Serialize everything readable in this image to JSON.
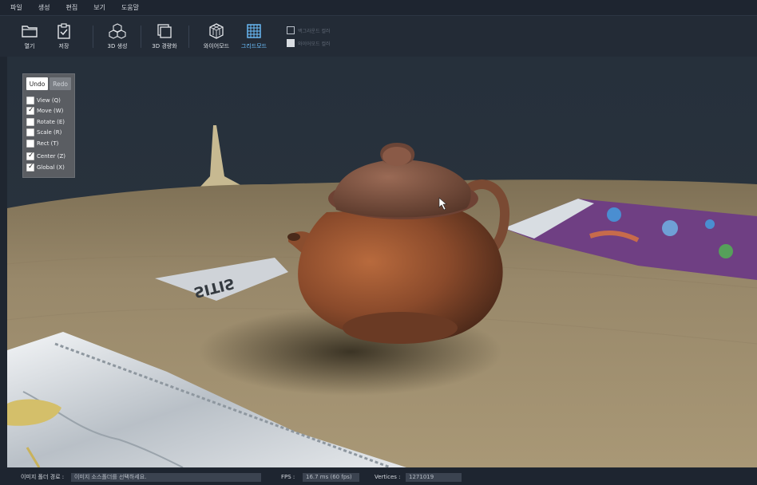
{
  "menubar": {
    "items": [
      "파일",
      "생성",
      "편집",
      "보기",
      "도움말"
    ]
  },
  "toolbar": {
    "open_label": "열기",
    "save_label": "저장",
    "gen3d_label": "3D 생성",
    "lightweight_label": "3D 경량화",
    "wireframe_label": "와이어모드",
    "grid_label": "그리드모드",
    "active_tool": "그리드모드",
    "bg_color_label": "백그라운드 컬러",
    "wire_color_label": "와이어모드 컬러",
    "accent_color": "#6cc0ff"
  },
  "panel": {
    "undo_label": "Undo",
    "redo_label": "Redo",
    "options": [
      {
        "label": "View (Q)",
        "checked": false
      },
      {
        "label": "Move (W)",
        "checked": true
      },
      {
        "label": "Rotate (E)",
        "checked": false
      },
      {
        "label": "Scale (R)",
        "checked": false
      },
      {
        "label": "Rect (T)",
        "checked": false
      },
      {
        "label": "Center (Z)",
        "checked": true
      },
      {
        "label": "Global (X)",
        "checked": true
      }
    ]
  },
  "viewport": {
    "subject": "teapot-3d-mesh"
  },
  "status": {
    "folder_label": "이미지 폴더 경로 :",
    "folder_value": "이미지 소스폴더를 선택하세요.",
    "fps_label": "FPS :",
    "fps_value": "16.7 ms (60 fps)",
    "vertices_label": "Vertices :",
    "vertices_value": "1271019"
  }
}
